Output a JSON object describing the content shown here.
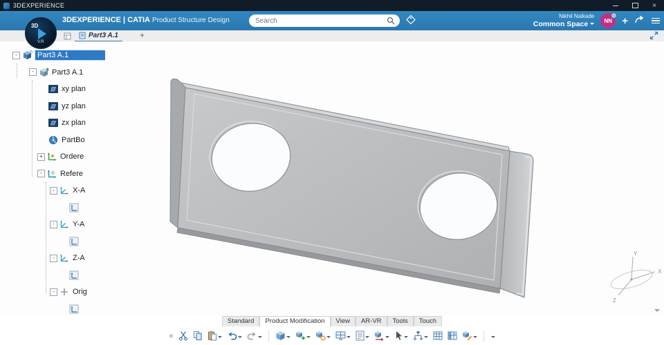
{
  "window": {
    "title": "3DEXPERIENCE",
    "controls": {
      "close": "×"
    }
  },
  "header": {
    "brand": "3DEXPERIENCE",
    "separator": "|",
    "app": "CATIA",
    "module": "Product Structure Design",
    "search_placeholder": "Search",
    "user_name": "Nikhil Naikade",
    "workspace": "Common Space",
    "avatar_initials": "NN",
    "accent_blue": "#2d7cb8",
    "avatar_color": "#c22f84"
  },
  "tabbar": {
    "tab": "Part3 A.1",
    "new_tab": "+"
  },
  "tree": {
    "items": [
      {
        "label": "Part3 A.1",
        "icon": "product-icon",
        "level": 0,
        "expander": "minus",
        "selected": true
      },
      {
        "label": "Part3 A.1",
        "icon": "part-icon",
        "level": 1,
        "expander": "minus"
      },
      {
        "label": "xy plan",
        "icon": "plane-icon",
        "level": 2,
        "expander": "none"
      },
      {
        "label": "yz plan",
        "icon": "plane-icon",
        "level": 2,
        "expander": "none"
      },
      {
        "label": "zx plan",
        "icon": "plane-icon",
        "level": 2,
        "expander": "none"
      },
      {
        "label": "PartBo",
        "icon": "partbody-icon",
        "level": 2,
        "expander": "none"
      },
      {
        "label": "Ordere",
        "icon": "ordered-set-icon",
        "level": 2,
        "expander": "plus"
      },
      {
        "label": "Refere",
        "icon": "references-icon",
        "level": 2,
        "expander": "minus"
      },
      {
        "label": "X-A",
        "icon": "axis-icon",
        "level": 3,
        "expander": "minus"
      },
      {
        "label": "",
        "icon": "axis-system-icon",
        "level": 4,
        "expander": "none"
      },
      {
        "label": "Y-A",
        "icon": "axis-icon",
        "level": 3,
        "expander": "minus"
      },
      {
        "label": "",
        "icon": "axis-system-icon",
        "level": 4,
        "expander": "none"
      },
      {
        "label": "Z-A",
        "icon": "axis-icon",
        "level": 3,
        "expander": "minus"
      },
      {
        "label": "",
        "icon": "axis-system-icon",
        "level": 4,
        "expander": "none"
      },
      {
        "label": "Orig",
        "icon": "point-icon",
        "level": 3,
        "expander": "minus"
      },
      {
        "label": "",
        "icon": "axis-system-icon",
        "level": 4,
        "expander": "none"
      }
    ]
  },
  "viewport": {
    "axis_labels": {
      "x": "X",
      "y": "Y",
      "z": "Z"
    },
    "part_color": "#bcbfc1"
  },
  "bottom_tabs": {
    "items": [
      {
        "label": "Standard"
      },
      {
        "label": "Product Modification",
        "active": true
      },
      {
        "label": "View"
      },
      {
        "label": "AR-VR"
      },
      {
        "label": "Tools"
      },
      {
        "label": "Touch"
      }
    ]
  },
  "toolbar": {
    "collapse_glyph": "«",
    "icons": [
      {
        "name": "toolbar-collapse-icon",
        "dropdown": false
      },
      {
        "name": "cut-icon",
        "dropdown": false
      },
      {
        "name": "copy-icon",
        "dropdown": false
      },
      {
        "name": "paste-icon",
        "dropdown": true
      },
      {
        "name": "undo-icon",
        "dropdown": true
      },
      {
        "name": "redo-icon",
        "dropdown": true
      },
      {
        "name": "insert-component-icon",
        "dropdown": true
      },
      {
        "name": "new-component-icon",
        "dropdown": true
      },
      {
        "name": "manage-components-icon",
        "dropdown": true
      },
      {
        "name": "window-layout-icon",
        "dropdown": true
      },
      {
        "name": "properties-icon",
        "dropdown": true
      },
      {
        "name": "replace-component-icon",
        "dropdown": true
      },
      {
        "name": "select-mode-icon",
        "dropdown": true
      },
      {
        "name": "design-graph-icon",
        "dropdown": true
      },
      {
        "name": "table-view-icon",
        "dropdown": false
      },
      {
        "name": "matrix-view-icon",
        "dropdown": false
      },
      {
        "name": "edit-component-icon",
        "dropdown": true
      },
      {
        "name": "toolbar-overflow-icon",
        "dropdown": false
      }
    ]
  }
}
